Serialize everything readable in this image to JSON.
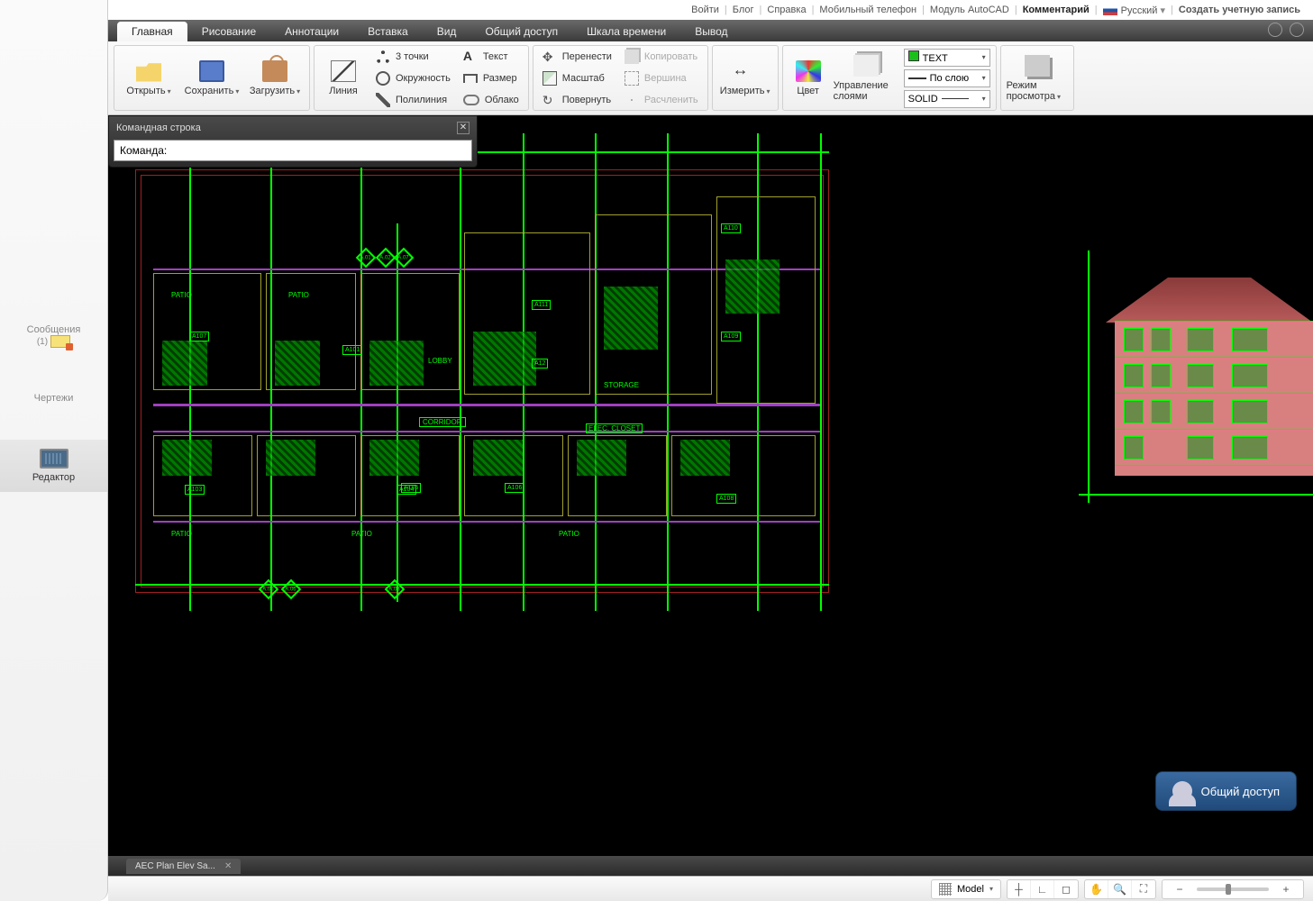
{
  "linkbar": {
    "login": "Войти",
    "blog": "Блог",
    "help": "Справка",
    "mobile": "Мобильный телефон",
    "autocad": "Модуль AutoCAD",
    "comment": "Комментарий",
    "language": "Русский",
    "create_account": "Создать учетную запись"
  },
  "tabs": {
    "home": "Главная",
    "drawing": "Рисование",
    "annotations": "Аннотации",
    "insert": "Вставка",
    "view": "Вид",
    "sharing": "Общий доступ",
    "timeline": "Шкала времени",
    "output": "Вывод"
  },
  "ribbon": {
    "open": "Открыть",
    "save": "Сохранить",
    "load": "Загрузить",
    "line": "Линия",
    "three_points": "3 точки",
    "circle": "Окружность",
    "polyline": "Полилиния",
    "text": "Текст",
    "dimension": "Размер",
    "cloud": "Облако",
    "move": "Перенести",
    "scale": "Масштаб",
    "rotate": "Повернуть",
    "copy": "Копировать",
    "vertex": "Вершина",
    "explode": "Расчленить",
    "measure": "Измерить",
    "color": "Цвет",
    "layers_mgmt": "Управление слоями",
    "layer_sel": "TEXT",
    "lineweight_sel": "По слою",
    "linetype_sel": "SOLID",
    "viewmode": "Режим просмотра"
  },
  "sidebar": {
    "messages_label": "Сообщения",
    "messages_count": "(1)",
    "drawings": "Чертежи",
    "editor": "Редактор"
  },
  "command": {
    "title": "Командная строка",
    "prompt": "Команда:"
  },
  "plan_labels": {
    "a107": "A107",
    "a101": "A101",
    "a110": "A110",
    "a111": "A111",
    "a12": "A12",
    "a109": "A109",
    "a103": "A103",
    "a104": "A104",
    "a105": "A105",
    "a106": "A106",
    "a108": "A108",
    "lobby": "LOBBY",
    "storage": "STORAGE",
    "corridor": "CORRIDOR",
    "elec_closet": "ELEC. CLOSET",
    "patio": "PATIO",
    "m_a01": "A.01",
    "m_a02": "A.02",
    "m_a03": "A.03",
    "m_a05": "A.05",
    "m_a06": "A.06",
    "m_a07": "A.07"
  },
  "share_label": "Общий доступ",
  "file_tab": "AEC Plan Elev Sa...",
  "status": {
    "model": "Model"
  }
}
